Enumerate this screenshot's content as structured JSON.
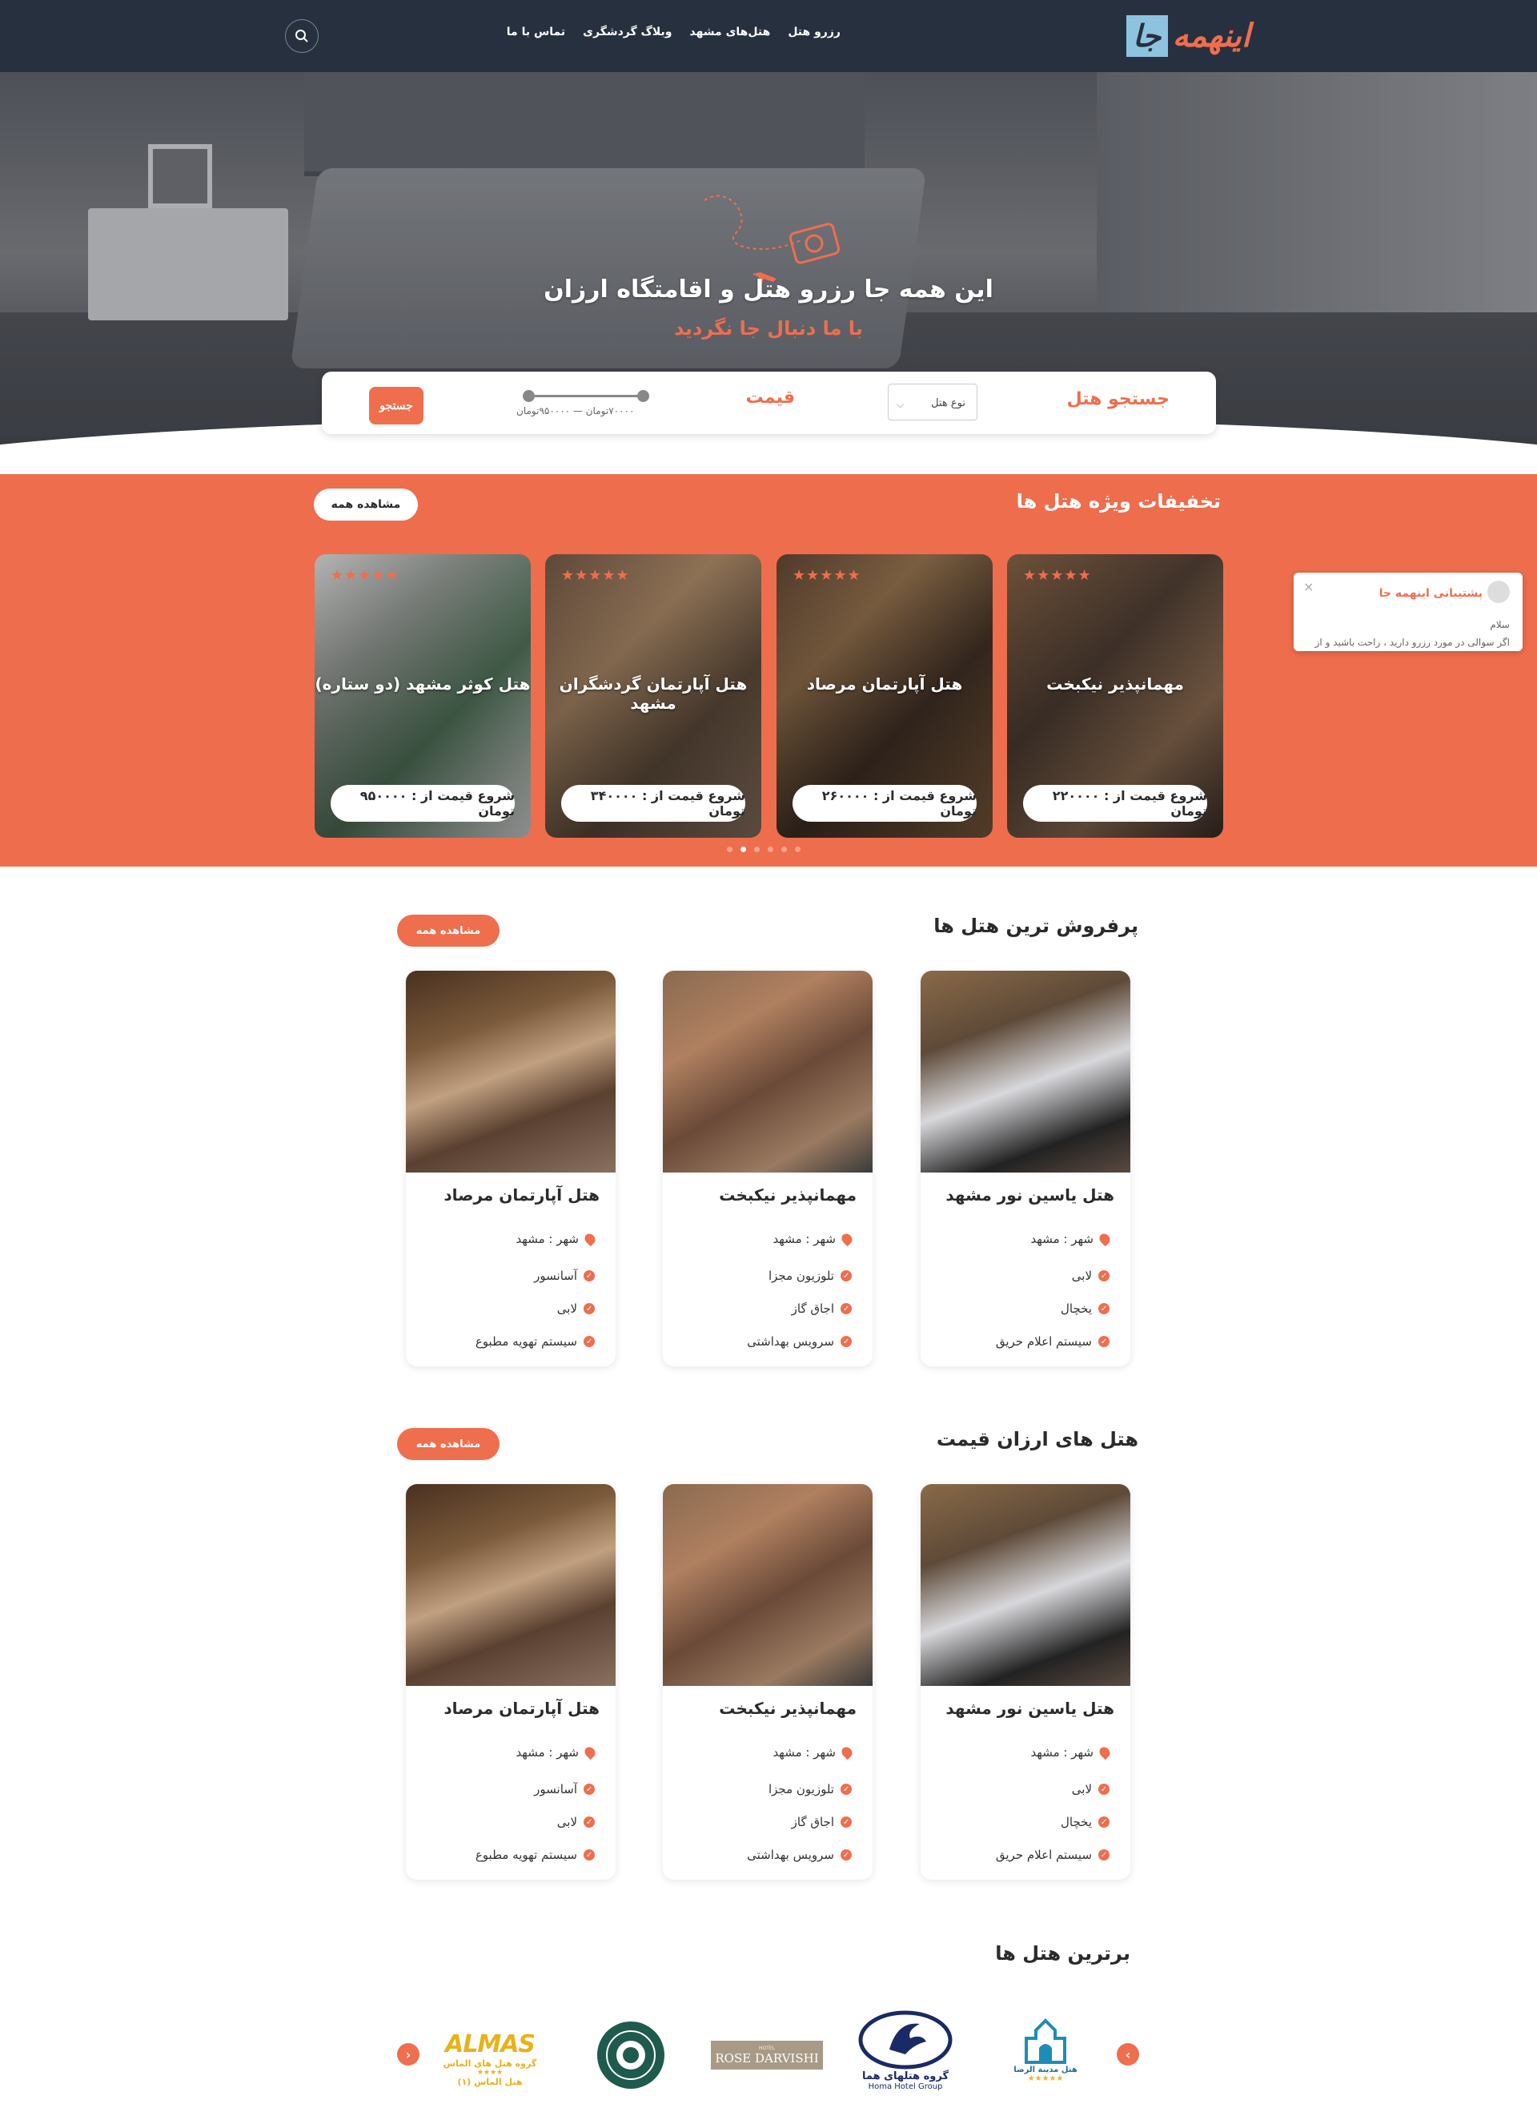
{
  "header": {
    "logo_text": "اینهمه",
    "logo_box": "جا",
    "menu": [
      "رزرو هتل",
      "هتل‌های مشهد",
      "وبلاگ گردشگری",
      "تماس با ما"
    ]
  },
  "hero": {
    "title": "این همه جا رزرو هتل و اقامتگاه ارزان",
    "subtitle": "با ما دنبال جا نگردید"
  },
  "search": {
    "hotel_label": "جستجو هتل",
    "hotel_type_placeholder": "نوع هتل",
    "price_label": "قیمت",
    "price_range_text": "۷۰۰۰۰تومان — ۹۵۰۰۰۰تومان",
    "price_min": 70000,
    "price_max": 950000,
    "button": "جستجو"
  },
  "offers": {
    "title": "تخفیفات ویژه هتل ها",
    "see_all": "مشاهده همه",
    "cards": [
      {
        "name": "مهمانپذیر نیکبخت",
        "price": "شروع قیمت از : ۲۲۰۰۰۰ تومان",
        "stars": 5
      },
      {
        "name": "هتل آپارتمان مرصاد",
        "price": "شروع قیمت از : ۲۶۰۰۰۰ تومان",
        "stars": 5
      },
      {
        "name": "هتل آپارتمان گردشگران مشهد",
        "price": "شروع قیمت از : ۳۴۰۰۰۰ تومان",
        "stars": 5
      },
      {
        "name": "هتل کوثر مشهد (دو ستاره)",
        "price": "شروع قیمت از : ۹۵۰۰۰۰ تومان",
        "stars": 5
      }
    ],
    "dots": 6,
    "active_dot": 4
  },
  "support": {
    "title": "پشتیبانی اینهمه جا",
    "line1": "سلام",
    "line2": "اگر سوالی در مورد رزرو دارید ، راحت باشید و از",
    "close": "×"
  },
  "bestsellers": {
    "title": "پرفروش ترین هتل ها",
    "see_all": "مشاهده همه",
    "cards": [
      {
        "name": "هتل یاسین نور مشهد",
        "city": "شهر : مشهد",
        "features": [
          "لابی",
          "یخچال",
          "سیستم اعلام حریق"
        ]
      },
      {
        "name": "مهمانپذیر نیکبخت",
        "city": "شهر : مشهد",
        "features": [
          "تلوزیون مجزا",
          "اجاق گاز",
          "سرویس بهداشتی"
        ]
      },
      {
        "name": "هتل آپارتمان مرصاد",
        "city": "شهر : مشهد",
        "features": [
          "آسانسور",
          "لابی",
          "سیستم تهویه مطبوع"
        ]
      }
    ]
  },
  "cheap": {
    "title": "هتل های ارزان قیمت",
    "see_all": "مشاهده همه",
    "cards": [
      {
        "name": "هتل یاسین نور مشهد",
        "city": "شهر : مشهد",
        "features": [
          "لابی",
          "یخچال",
          "سیستم اعلام حریق"
        ]
      },
      {
        "name": "مهمانپذیر نیکبخت",
        "city": "شهر : مشهد",
        "features": [
          "تلوزیون مجزا",
          "اجاق گاز",
          "سرویس بهداشتی"
        ]
      },
      {
        "name": "هتل آپارتمان مرصاد",
        "city": "شهر : مشهد",
        "features": [
          "آسانسور",
          "لابی",
          "سیستم تهویه مطبوع"
        ]
      }
    ]
  },
  "brands": {
    "title": "برترین هتل ها",
    "items": [
      {
        "name": "هتل مدینة الرضا",
        "icon": "madinat-alreza-logo"
      },
      {
        "name": "گروه هتلهای هما",
        "sub": "Homa Hotel Group",
        "icon": "homa-logo"
      },
      {
        "name": "ROSE DARVISHI",
        "sub": "HOTEL",
        "icon": "rose-darvishi-logo"
      },
      {
        "name": "",
        "icon": "ornament-seal-logo"
      },
      {
        "name": "ALMAS",
        "sub": "گروه هتل های الماس",
        "sub2": "هتل الماس (۱)",
        "icon": "almas-logo"
      }
    ]
  },
  "colors": {
    "accent": "#ee6d4d",
    "nav": "#27303f"
  }
}
